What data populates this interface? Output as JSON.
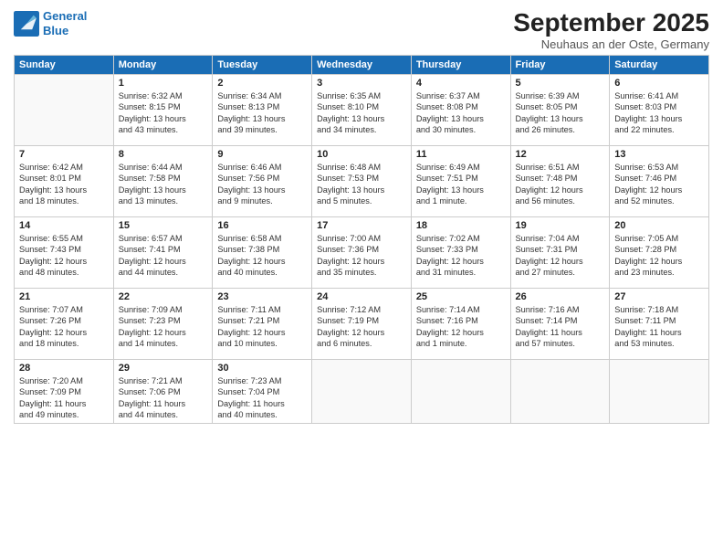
{
  "header": {
    "logo_line1": "General",
    "logo_line2": "Blue",
    "month": "September 2025",
    "location": "Neuhaus an der Oste, Germany"
  },
  "weekdays": [
    "Sunday",
    "Monday",
    "Tuesday",
    "Wednesday",
    "Thursday",
    "Friday",
    "Saturday"
  ],
  "weeks": [
    [
      {
        "day": "",
        "info": ""
      },
      {
        "day": "1",
        "info": "Sunrise: 6:32 AM\nSunset: 8:15 PM\nDaylight: 13 hours\nand 43 minutes."
      },
      {
        "day": "2",
        "info": "Sunrise: 6:34 AM\nSunset: 8:13 PM\nDaylight: 13 hours\nand 39 minutes."
      },
      {
        "day": "3",
        "info": "Sunrise: 6:35 AM\nSunset: 8:10 PM\nDaylight: 13 hours\nand 34 minutes."
      },
      {
        "day": "4",
        "info": "Sunrise: 6:37 AM\nSunset: 8:08 PM\nDaylight: 13 hours\nand 30 minutes."
      },
      {
        "day": "5",
        "info": "Sunrise: 6:39 AM\nSunset: 8:05 PM\nDaylight: 13 hours\nand 26 minutes."
      },
      {
        "day": "6",
        "info": "Sunrise: 6:41 AM\nSunset: 8:03 PM\nDaylight: 13 hours\nand 22 minutes."
      }
    ],
    [
      {
        "day": "7",
        "info": "Sunrise: 6:42 AM\nSunset: 8:01 PM\nDaylight: 13 hours\nand 18 minutes."
      },
      {
        "day": "8",
        "info": "Sunrise: 6:44 AM\nSunset: 7:58 PM\nDaylight: 13 hours\nand 13 minutes."
      },
      {
        "day": "9",
        "info": "Sunrise: 6:46 AM\nSunset: 7:56 PM\nDaylight: 13 hours\nand 9 minutes."
      },
      {
        "day": "10",
        "info": "Sunrise: 6:48 AM\nSunset: 7:53 PM\nDaylight: 13 hours\nand 5 minutes."
      },
      {
        "day": "11",
        "info": "Sunrise: 6:49 AM\nSunset: 7:51 PM\nDaylight: 13 hours\nand 1 minute."
      },
      {
        "day": "12",
        "info": "Sunrise: 6:51 AM\nSunset: 7:48 PM\nDaylight: 12 hours\nand 56 minutes."
      },
      {
        "day": "13",
        "info": "Sunrise: 6:53 AM\nSunset: 7:46 PM\nDaylight: 12 hours\nand 52 minutes."
      }
    ],
    [
      {
        "day": "14",
        "info": "Sunrise: 6:55 AM\nSunset: 7:43 PM\nDaylight: 12 hours\nand 48 minutes."
      },
      {
        "day": "15",
        "info": "Sunrise: 6:57 AM\nSunset: 7:41 PM\nDaylight: 12 hours\nand 44 minutes."
      },
      {
        "day": "16",
        "info": "Sunrise: 6:58 AM\nSunset: 7:38 PM\nDaylight: 12 hours\nand 40 minutes."
      },
      {
        "day": "17",
        "info": "Sunrise: 7:00 AM\nSunset: 7:36 PM\nDaylight: 12 hours\nand 35 minutes."
      },
      {
        "day": "18",
        "info": "Sunrise: 7:02 AM\nSunset: 7:33 PM\nDaylight: 12 hours\nand 31 minutes."
      },
      {
        "day": "19",
        "info": "Sunrise: 7:04 AM\nSunset: 7:31 PM\nDaylight: 12 hours\nand 27 minutes."
      },
      {
        "day": "20",
        "info": "Sunrise: 7:05 AM\nSunset: 7:28 PM\nDaylight: 12 hours\nand 23 minutes."
      }
    ],
    [
      {
        "day": "21",
        "info": "Sunrise: 7:07 AM\nSunset: 7:26 PM\nDaylight: 12 hours\nand 18 minutes."
      },
      {
        "day": "22",
        "info": "Sunrise: 7:09 AM\nSunset: 7:23 PM\nDaylight: 12 hours\nand 14 minutes."
      },
      {
        "day": "23",
        "info": "Sunrise: 7:11 AM\nSunset: 7:21 PM\nDaylight: 12 hours\nand 10 minutes."
      },
      {
        "day": "24",
        "info": "Sunrise: 7:12 AM\nSunset: 7:19 PM\nDaylight: 12 hours\nand 6 minutes."
      },
      {
        "day": "25",
        "info": "Sunrise: 7:14 AM\nSunset: 7:16 PM\nDaylight: 12 hours\nand 1 minute."
      },
      {
        "day": "26",
        "info": "Sunrise: 7:16 AM\nSunset: 7:14 PM\nDaylight: 11 hours\nand 57 minutes."
      },
      {
        "day": "27",
        "info": "Sunrise: 7:18 AM\nSunset: 7:11 PM\nDaylight: 11 hours\nand 53 minutes."
      }
    ],
    [
      {
        "day": "28",
        "info": "Sunrise: 7:20 AM\nSunset: 7:09 PM\nDaylight: 11 hours\nand 49 minutes."
      },
      {
        "day": "29",
        "info": "Sunrise: 7:21 AM\nSunset: 7:06 PM\nDaylight: 11 hours\nand 44 minutes."
      },
      {
        "day": "30",
        "info": "Sunrise: 7:23 AM\nSunset: 7:04 PM\nDaylight: 11 hours\nand 40 minutes."
      },
      {
        "day": "",
        "info": ""
      },
      {
        "day": "",
        "info": ""
      },
      {
        "day": "",
        "info": ""
      },
      {
        "day": "",
        "info": ""
      }
    ]
  ]
}
